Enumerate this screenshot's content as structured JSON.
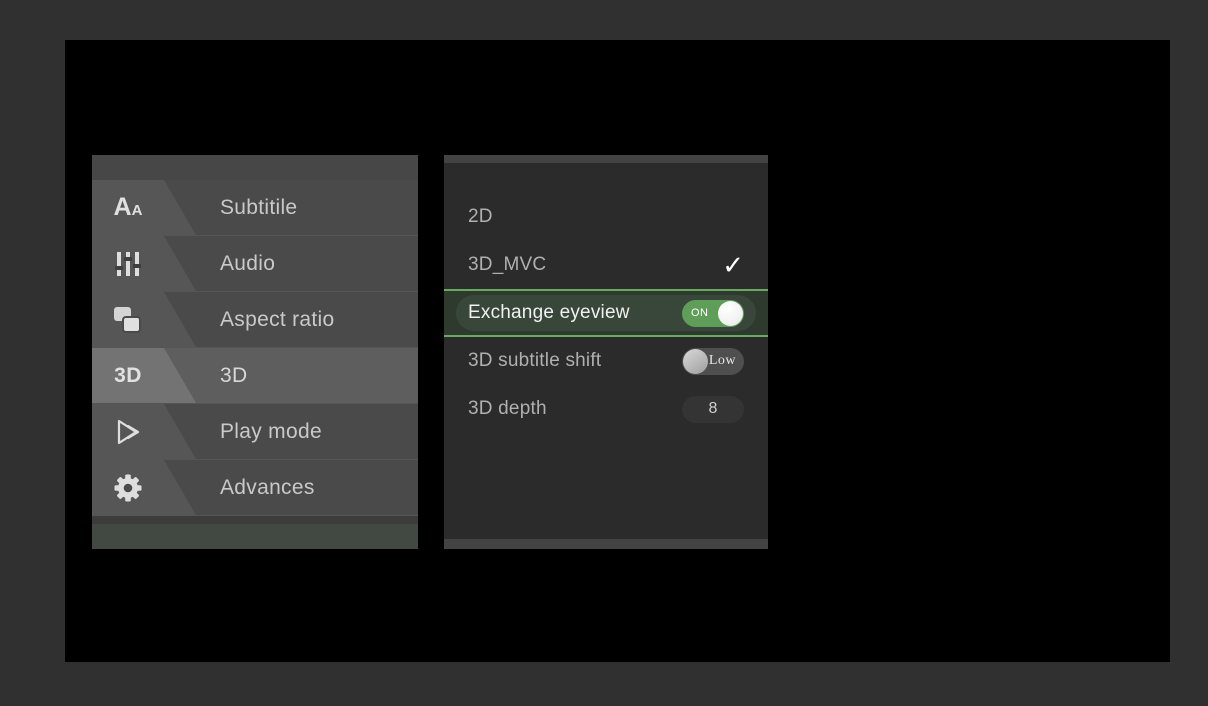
{
  "app": {
    "background_color": "#303030",
    "screen_color": "#000000",
    "accent_color": "#6aa963",
    "toggle_on_color": "#5f9e58"
  },
  "sidebar": {
    "items": [
      {
        "label": "Subtitile",
        "icon": "text-size-icon",
        "selected": false
      },
      {
        "label": "Audio",
        "icon": "equalizer-icon",
        "selected": false
      },
      {
        "label": "Aspect ratio",
        "icon": "layers-icon",
        "selected": false
      },
      {
        "label": "3D",
        "icon": "3d-icon",
        "selected": true,
        "icon_text": "3D"
      },
      {
        "label": "Play mode",
        "icon": "play-icon",
        "selected": false
      },
      {
        "label": "Advances",
        "icon": "gear-icon",
        "selected": false
      }
    ]
  },
  "panel": {
    "options": [
      {
        "label": "2D",
        "control": "none",
        "selected": false
      },
      {
        "label": "3D_MVC",
        "control": "check",
        "selected": false,
        "checked": true,
        "check_glyph": "✓"
      },
      {
        "label": "Exchange eyeview",
        "control": "toggle",
        "selected": true,
        "toggle_state": "on",
        "toggle_text": "ON"
      },
      {
        "label": "3D subtitle shift",
        "control": "toggle",
        "selected": false,
        "toggle_state": "off",
        "toggle_text": "Low"
      },
      {
        "label": "3D depth",
        "control": "value",
        "selected": false,
        "value": "8"
      }
    ]
  }
}
